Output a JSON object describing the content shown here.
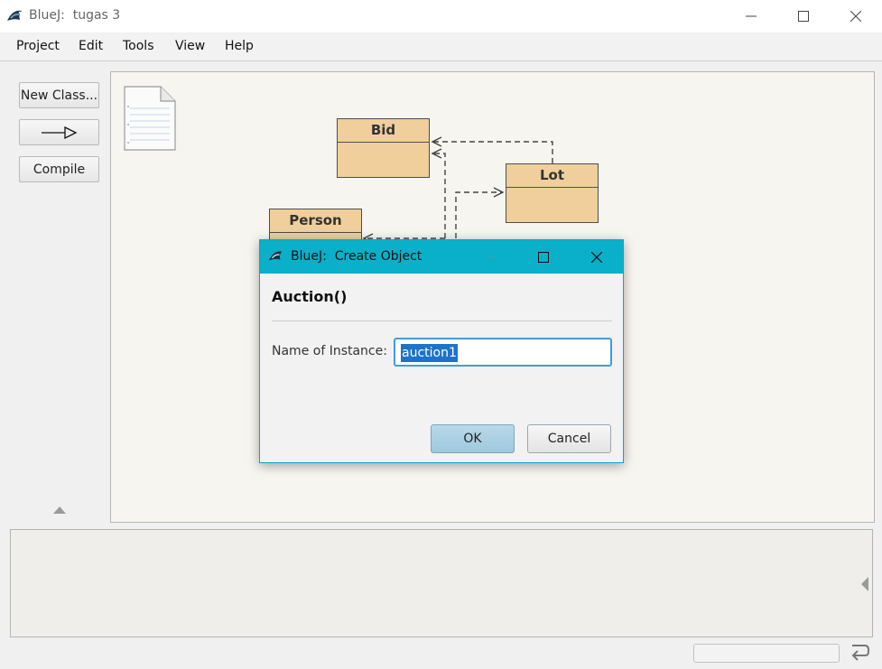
{
  "window": {
    "title": "BlueJ:  tugas 3",
    "minimize_glyph": "—",
    "maximize_glyph": "☐",
    "close_glyph": "✕"
  },
  "menu": [
    "Project",
    "Edit",
    "Tools",
    "View",
    "Help"
  ],
  "toolbar": {
    "new_class_label": "New Class...",
    "compile_label": "Compile"
  },
  "classes": [
    {
      "name": "Bid"
    },
    {
      "name": "Lot"
    },
    {
      "name": "Person"
    }
  ],
  "dialog": {
    "title": "BlueJ:  Create Object",
    "heading": "Auction()",
    "name_label": "Name of Instance:",
    "name_value": "auction1",
    "ok_label": "OK",
    "cancel_label": "Cancel"
  },
  "colors": {
    "class_fill": "#f0cf9c",
    "dialog_accent": "#0aafc9",
    "input_focus": "#3c9ee0"
  }
}
